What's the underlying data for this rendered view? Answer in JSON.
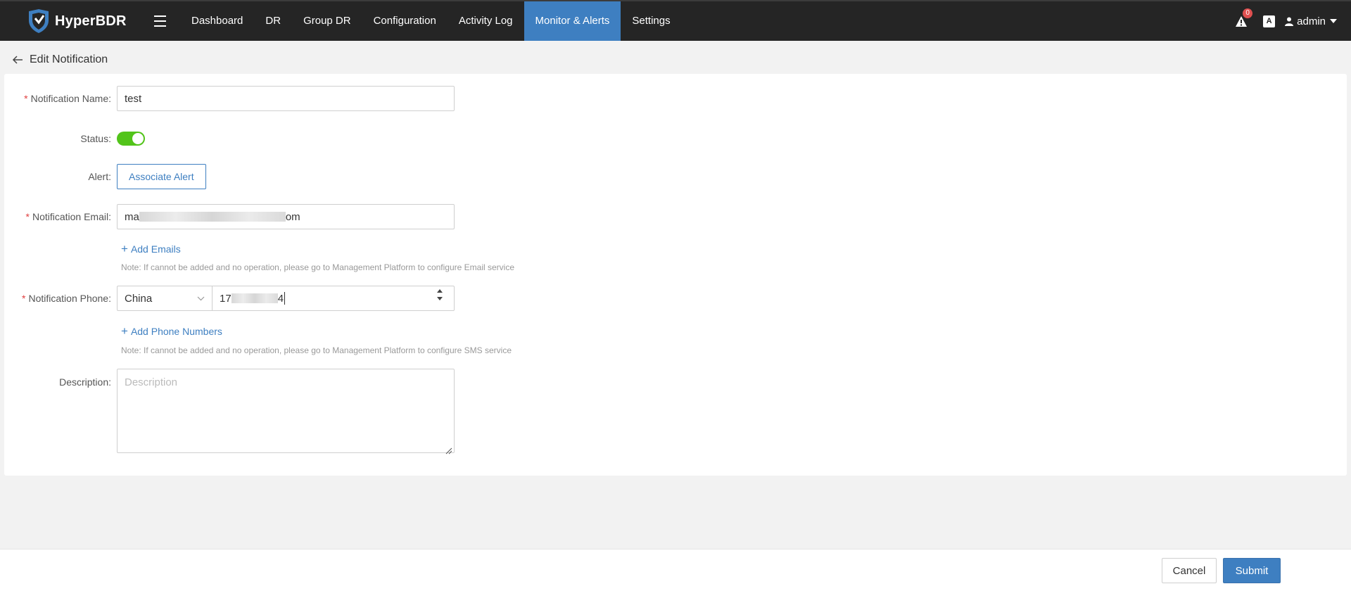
{
  "app": {
    "name": "HyperBDR"
  },
  "nav": {
    "items": [
      {
        "label": "Dashboard"
      },
      {
        "label": "DR"
      },
      {
        "label": "Group DR"
      },
      {
        "label": "Configuration"
      },
      {
        "label": "Activity Log"
      },
      {
        "label": "Monitor & Alerts"
      },
      {
        "label": "Settings"
      }
    ],
    "active": "Monitor & Alerts"
  },
  "header_tools": {
    "alert_count": "0",
    "font_icon": "A",
    "user": "admin"
  },
  "page": {
    "title": "Edit Notification"
  },
  "form": {
    "name": {
      "label": "Notification Name:",
      "value": "test"
    },
    "status": {
      "label": "Status:",
      "enabled": true
    },
    "alert": {
      "label": "Alert:",
      "button": "Associate Alert"
    },
    "email": {
      "label": "Notification Email:",
      "value_prefix": "ma",
      "value_suffix": "om",
      "add_label": "Add Emails",
      "note": "Note: If cannot be added and no operation, please go to Management Platform to configure Email service"
    },
    "phone": {
      "label": "Notification Phone:",
      "country": "China",
      "value_prefix": "17",
      "value_suffix": "4",
      "add_label": "Add Phone Numbers",
      "note": "Note: If cannot be added and no operation, please go to Management Platform to configure SMS service"
    },
    "description": {
      "label": "Description:",
      "placeholder": "Description",
      "value": ""
    }
  },
  "footer": {
    "cancel": "Cancel",
    "submit": "Submit"
  },
  "colors": {
    "topbar": "#252525",
    "accent": "#3e7fc1",
    "toggle_on": "#52c41a",
    "required": "#e04040"
  }
}
